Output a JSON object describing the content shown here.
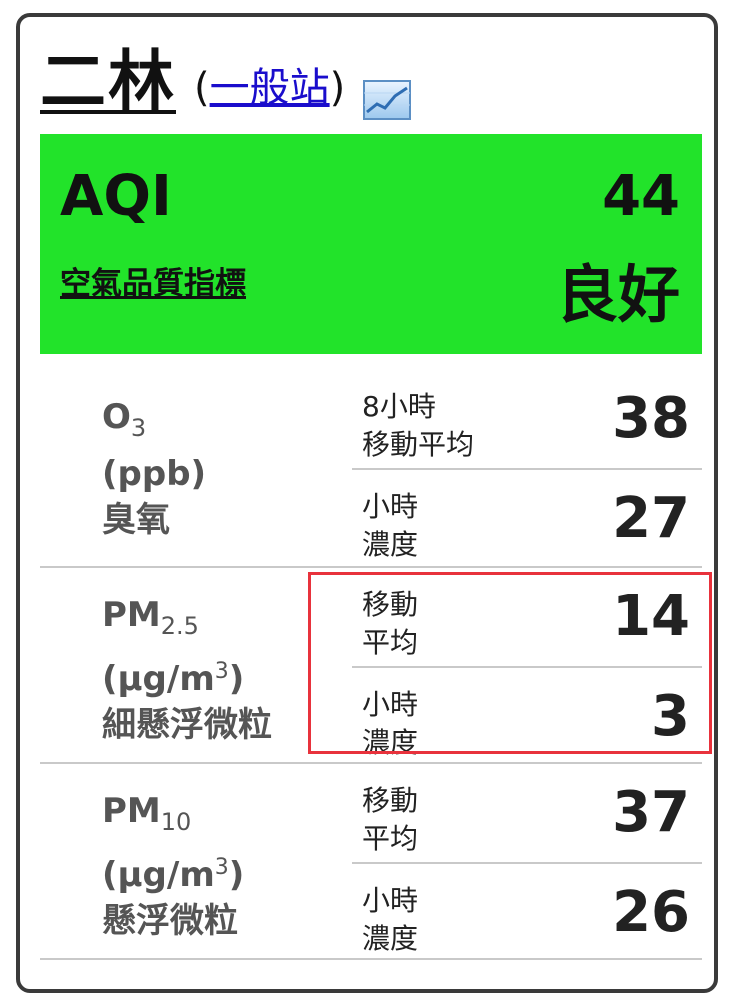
{
  "station": {
    "name": "二林",
    "type_open": "(",
    "type_label": "一般站",
    "type_close": ")",
    "chart_icon": "line-chart-icon"
  },
  "aqi": {
    "label": "AQI",
    "value": "44",
    "subtitle": "空氣品質指標",
    "status": "良好",
    "status_color": "#22e32a"
  },
  "pollutants": [
    {
      "symbol": "O",
      "subscript": "3",
      "unit_pre": "(ppb)",
      "unit_sup": "",
      "unit_post": "",
      "name": "臭氧",
      "metrics": [
        {
          "label": "8小時\n移動平均",
          "value": "38"
        },
        {
          "label": "小時\n濃度",
          "value": "27"
        }
      ]
    },
    {
      "symbol": "PM",
      "subscript": "2.5",
      "unit_pre": "(μg/m",
      "unit_sup": "3",
      "unit_post": ")",
      "name": "細懸浮微粒",
      "metrics": [
        {
          "label": "移動\n平均",
          "value": "14"
        },
        {
          "label": "小時\n濃度",
          "value": "3"
        }
      ]
    },
    {
      "symbol": "PM",
      "subscript": "10",
      "unit_pre": "(μg/m",
      "unit_sup": "3",
      "unit_post": ")",
      "name": "懸浮微粒",
      "metrics": [
        {
          "label": "移動\n平均",
          "value": "37"
        },
        {
          "label": "小時\n濃度",
          "value": "26"
        }
      ]
    }
  ],
  "highlight_color": "#e8323c"
}
